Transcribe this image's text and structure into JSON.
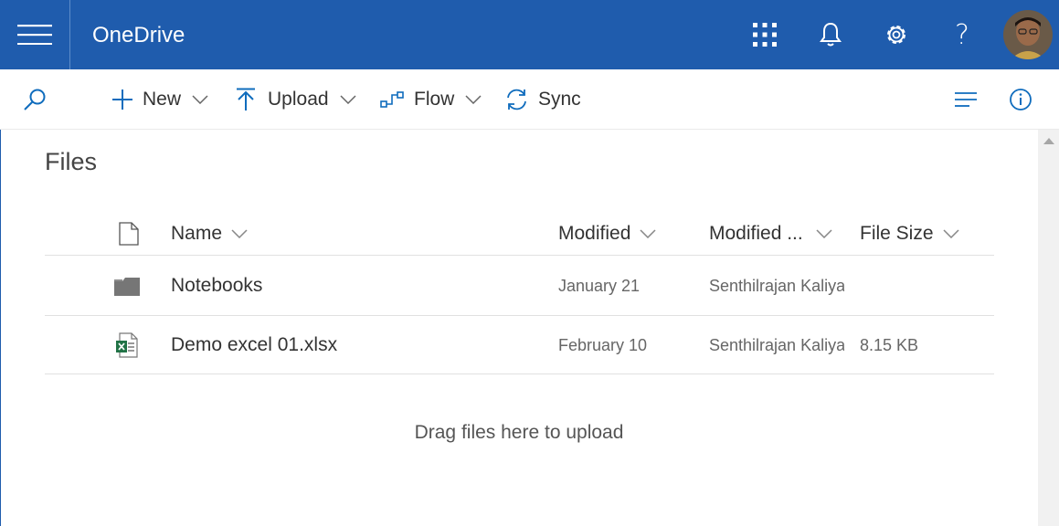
{
  "suite": {
    "app_name": "OneDrive",
    "icons": [
      "hamburger-icon",
      "app-launcher-icon",
      "bell-icon",
      "gear-icon",
      "help-icon"
    ],
    "help_glyph": "?"
  },
  "commands": {
    "new_label": "New",
    "upload_label": "Upload",
    "flow_label": "Flow",
    "sync_label": "Sync"
  },
  "page": {
    "title": "Files"
  },
  "columns": {
    "name": "Name",
    "modified": "Modified",
    "modified_by": "Modified ...",
    "file_size": "File Size"
  },
  "files": [
    {
      "name": "Notebooks",
      "type": "folder",
      "modified": "January 21",
      "modified_by": "Senthilrajan Kaliyap",
      "size": ""
    },
    {
      "name": "Demo excel 01.xlsx",
      "type": "excel",
      "modified": "February 10",
      "modified_by": "Senthilrajan Kaliyap",
      "size": "8.15 KB"
    }
  ],
  "drop_hint": "Drag files here to upload",
  "colors": {
    "suite_bar": "#1f5cad",
    "accent": "#0f6cbd",
    "excel_green": "#217346"
  }
}
